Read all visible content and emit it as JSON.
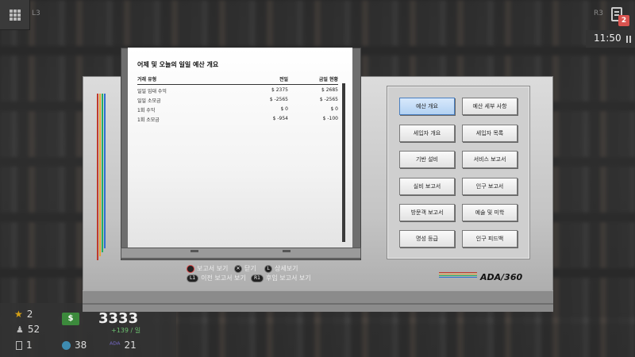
{
  "hud": {
    "l3": "L3",
    "r3": "R3",
    "notification_count": "2",
    "time": "11:50"
  },
  "stats": {
    "stars": "2",
    "visitors": "52",
    "tenants": "1",
    "money_tag": "$",
    "money": "3333",
    "income": "+139 / 일",
    "globe": "38",
    "ada": "21"
  },
  "report": {
    "title": "어제 및 오늘의 일일 예산 개요",
    "columns": [
      "거래 유형",
      "전일",
      "금일 현황"
    ],
    "rows": [
      {
        "type": "일일 임대 수익",
        "yesterday": "$ 2375",
        "today": "$ 2685"
      },
      {
        "type": "일일 소모금",
        "yesterday": "$ -2565",
        "today": "$ -2565"
      },
      {
        "type": "1회 수익",
        "yesterday": "$ 0",
        "today": "$ 0"
      },
      {
        "type": "1회 소모금",
        "yesterday": "$ -954",
        "today": "$ -100"
      }
    ]
  },
  "controls": {
    "view_report": "보고서 보기",
    "close": "닫기",
    "details": "상세보기",
    "prev_report": "이전 보고서 보기",
    "next_report": "후임 보고서 보기",
    "btn_o": "",
    "btn_x": "✕",
    "btn_l": "L",
    "btn_l1": "L1",
    "btn_r1": "R1"
  },
  "menu": {
    "budget_overview": "예산 개요",
    "budget_details": "예산 세부 사항",
    "tenant_overview": "세입자 개요",
    "tenant_list": "세입자 목록",
    "infrastructure": "기반 설비",
    "service_report": "서비스 보고서",
    "office_report": "실비 보고서",
    "population_report": "인구 보고서",
    "visitor_report": "방문객 보고서",
    "art_aesthetics": "예술 및 미학",
    "reputation": "명성 등급",
    "population_feedback": "인구 피드백"
  },
  "brand": {
    "logo": "ADA/360",
    "bar_colors": [
      "#c0392b",
      "#e6a23c",
      "#27ae60",
      "#2e6fd1"
    ]
  }
}
